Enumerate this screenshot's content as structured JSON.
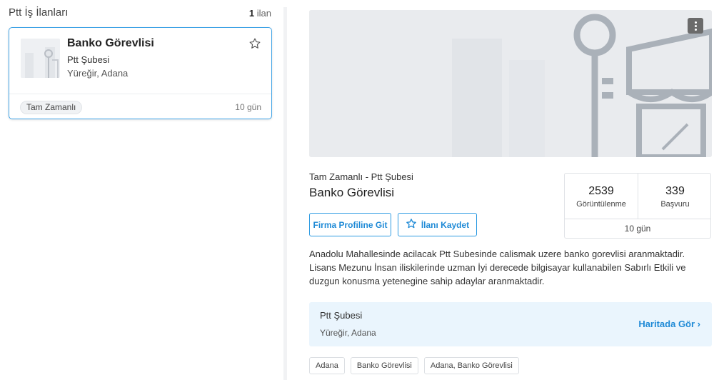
{
  "list": {
    "title": "Ptt İş İlanları",
    "count_number": "1",
    "count_label": " ilan"
  },
  "card": {
    "title": "Banko Görevlisi",
    "company": "Ptt Şubesi",
    "location": "Yüreğir, Adana",
    "badge": "Tam Zamanlı",
    "days": "10 gün"
  },
  "detail": {
    "subtitle": "Tam Zamanlı - Ptt Şubesi",
    "title": "Banko Görevlisi",
    "profile_button": "Firma Profiline Git",
    "save_button": "İlanı Kaydet",
    "stats": {
      "views": "2539",
      "views_label": "Görüntülenme",
      "applications": "339",
      "applications_label": "Başvuru",
      "days": "10 gün"
    },
    "description": "Anadolu Mahallesinde acilacak Ptt Subesinde calismak uzere banko gorevlisi aranmaktadir. Lisans Mezunu İnsan iliskilerinde uzman İyi derecede bilgisayar kullanabilen Sabırlı Etkili ve duzgun konusma yetenegine sahip adaylar aranmaktadir.",
    "location": {
      "company": "Ptt Şubesi",
      "city": "Yüreğir, Adana",
      "map_link": "Haritada Gör ›"
    },
    "tags": [
      "Adana",
      "Banko Görevlisi",
      "Adana, Banko Görevlisi"
    ]
  },
  "colors": {
    "accent": "#1f8ad6",
    "border_active": "#3fa3e6",
    "location_bg": "#eaf5fd"
  },
  "icons": [
    "star-icon",
    "more-vertical-icon",
    "chevron-right-icon"
  ]
}
